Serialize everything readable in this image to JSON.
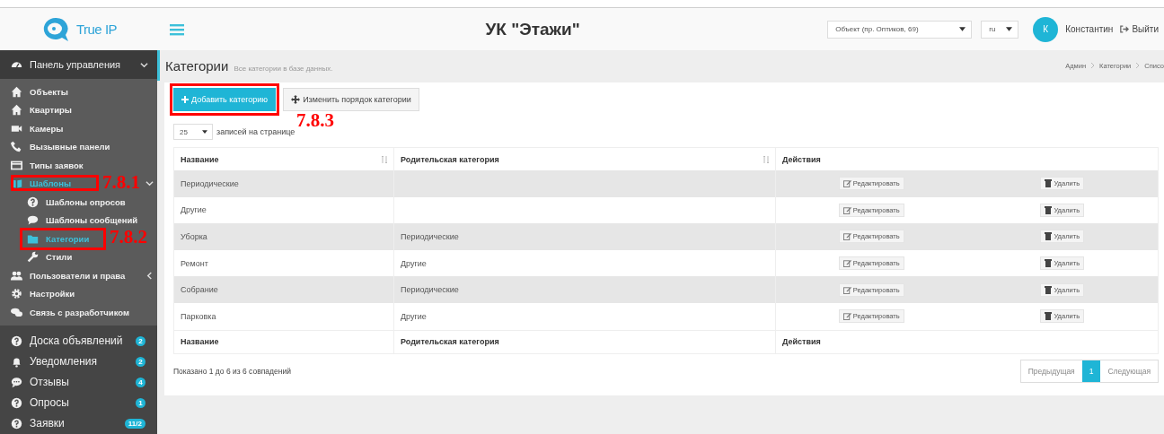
{
  "header": {
    "logo_text": "True IP",
    "title": "УК \"Этажи\"",
    "object_select": {
      "value": "Объект (пр. Оптиков, 69)"
    },
    "language_select": {
      "value": "ru"
    },
    "user": {
      "initial": "К",
      "name": "Константин"
    },
    "logout": "Выйти"
  },
  "sidebar": {
    "items": [
      {
        "label": "Панель управления",
        "expanded": true,
        "selected": false,
        "children": [
          {
            "label": "Объекты",
            "selected": false
          },
          {
            "label": "Квартиры",
            "selected": false
          },
          {
            "label": "Камеры",
            "selected": false
          },
          {
            "label": "Вызывные панели",
            "selected": false
          },
          {
            "label": "Типы заявок",
            "selected": false
          },
          {
            "label": "Шаблоны",
            "expanded": true,
            "selected": true,
            "annotation": "7.8.1",
            "children": [
              {
                "label": "Шаблоны опросов",
                "selected": false
              },
              {
                "label": "Шаблоны сообщений",
                "selected": false
              },
              {
                "label": "Категории",
                "selected": true,
                "annotation": "7.8.2"
              },
              {
                "label": "Стили",
                "selected": false
              }
            ]
          },
          {
            "label": "Пользователи и права",
            "expanded": false,
            "selected": false
          },
          {
            "label": "Настройки",
            "selected": false
          },
          {
            "label": "Связь с разработчиком",
            "selected": false
          }
        ]
      },
      {
        "label": "Доска объявлений",
        "selected": false,
        "badge": "2"
      },
      {
        "label": "Уведомления",
        "selected": false,
        "badge": "2"
      },
      {
        "label": "Отзывы",
        "selected": false,
        "badge": "4"
      },
      {
        "label": "Опросы",
        "selected": false,
        "badge": "1"
      },
      {
        "label": "Заявки",
        "selected": false,
        "badge": "11/2"
      }
    ]
  },
  "page": {
    "title": "Категории",
    "subtitle": "Все категории в базе данных.",
    "breadcrumb": [
      "Админ",
      "Категории",
      "Списо"
    ]
  },
  "toolbar": {
    "buttons": [
      {
        "kind": "primary",
        "label": "Добавить категорию",
        "annotation": "7.8.3"
      },
      {
        "kind": "default",
        "label": "Изменить порядок категории"
      }
    ]
  },
  "length_select": {
    "value": "25",
    "label": "записей на странице"
  },
  "table": {
    "columns": [
      {
        "label": "Название",
        "sortable": true
      },
      {
        "label": "Родительская категория",
        "sortable": true
      },
      {
        "label": "Действия",
        "sortable": false
      }
    ],
    "rows": [
      {
        "name": "Периодические",
        "actions": [
          "Редактировать",
          "Удалить"
        ]
      },
      {
        "name": "Другие",
        "actions": [
          "Редактировать",
          "Удалить"
        ]
      },
      {
        "name": "Уборка",
        "parent": "Периодические",
        "actions": [
          "Редактировать",
          "Удалить"
        ]
      },
      {
        "name": "Ремонт",
        "parent": "Другие",
        "actions": [
          "Редактировать",
          "Удалить"
        ]
      },
      {
        "name": "Собрание",
        "parent": "Периодические",
        "actions": [
          "Редактировать",
          "Удалить"
        ]
      },
      {
        "name": "Парковка",
        "parent": "Другие",
        "actions": [
          "Редактировать",
          "Удалить"
        ]
      }
    ],
    "footer": [
      "Название",
      "Родительская категория",
      "Действия"
    ]
  },
  "info": "Показано 1 до 6 из 6 совпадений",
  "pagination": [
    {
      "label": "Предыдущая",
      "selected": false
    },
    {
      "label": "1",
      "selected": true
    },
    {
      "label": "Следующая",
      "selected": false
    }
  ]
}
